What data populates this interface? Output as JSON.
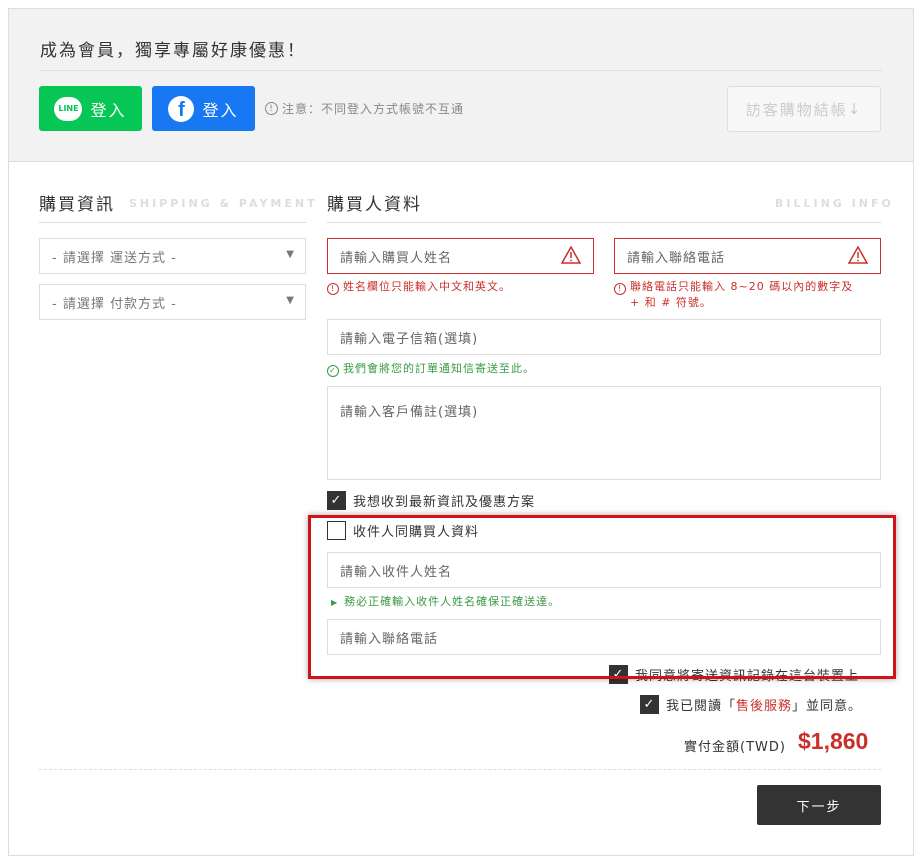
{
  "header": {
    "promo": "成為會員，獨享專屬好康優惠！",
    "line_logo": "LINE",
    "line_login": "登入",
    "fb_logo": "f",
    "fb_login": "登入",
    "note": "注意：不同登入方式帳號不互通",
    "guest_checkout": "訪客購物結帳"
  },
  "purchase": {
    "title": "購買資訊",
    "subtitle": "SHIPPING & PAYMENT",
    "shipping_select": "- 請選擇 運送方式 -",
    "payment_select": "- 請選擇 付款方式 -"
  },
  "buyer": {
    "title": "購買人資料",
    "subtitle": "BILLING INFO",
    "name_placeholder": "請輸入購買人姓名",
    "name_error": "姓名欄位只能輸入中文和英文。",
    "phone_placeholder": "請輸入聯絡電話",
    "phone_error_1": "聯絡電話只能輸入 8~20 碼以內的數字及",
    "phone_error_2": "+ 和 # 符號。",
    "email_placeholder": "請輸入電子信箱(選填)",
    "email_hint": "我們會將您的訂單通知信寄送至此。",
    "notes_placeholder": "請輸入客戶備註(選填)",
    "newsletter_label": "我想收到最新資訊及優惠方案"
  },
  "receiver": {
    "same_label": "收件人同購買人資料",
    "name_placeholder": "請輸入收件人姓名",
    "name_hint": "務必正確輸入收件人姓名確保正確送達。",
    "phone_placeholder": "請輸入聯絡電話"
  },
  "agreements": {
    "save_label": "我同意將寄送資訊記錄在這台裝置上",
    "terms_prefix": "我已閱讀「",
    "terms_link": "售後服務",
    "terms_suffix": "」並同意。"
  },
  "total": {
    "label": "實付金額(TWD)",
    "value": "$1,860"
  },
  "next_button": "下一步"
}
